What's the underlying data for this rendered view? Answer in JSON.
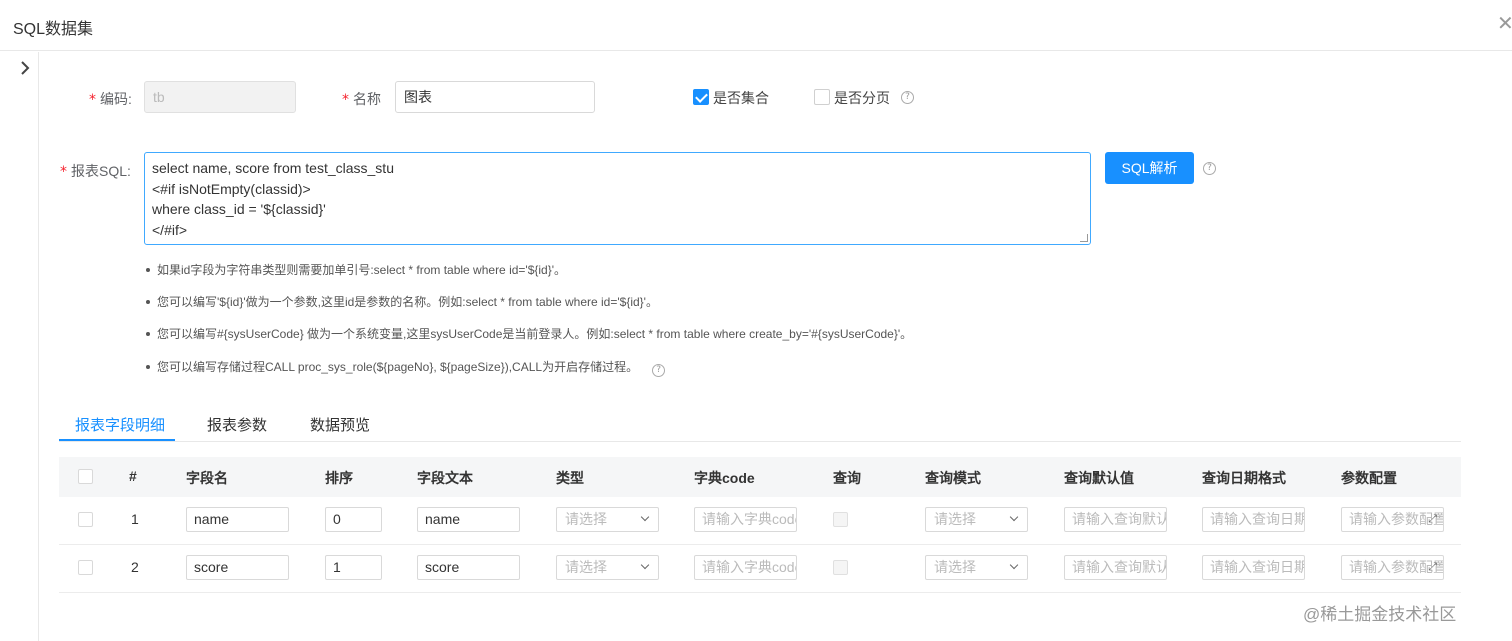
{
  "dialog": {
    "title": "SQL数据集",
    "close_icon": "✕"
  },
  "form": {
    "code": {
      "label": "编码:",
      "value": "tb"
    },
    "name": {
      "label": "名称",
      "value": "图表"
    },
    "is_collection": {
      "label": "是否集合",
      "checked": true
    },
    "is_paged": {
      "label": "是否分页",
      "checked": false
    },
    "sql": {
      "label": "报表SQL:",
      "lines": [
        "select name, score from test_class_stu",
        "<#if isNotEmpty(classid)>",
        "where class_id = '${classid}'",
        "</#if>"
      ]
    },
    "parse_button": "SQL解析",
    "tips": [
      "如果id字段为字符串类型则需要加单引号:select * from table where id='${id}'。",
      "您可以编写'${id}'做为一个参数,这里id是参数的名称。例如:select * from table where id='${id}'。",
      "您可以编写#{sysUserCode} 做为一个系统变量,这里sysUserCode是当前登录人。例如:select * from table where create_by='#{sysUserCode}'。",
      "您可以编写存储过程CALL proc_sys_role(${pageNo}, ${pageSize}),CALL为开启存储过程。"
    ]
  },
  "tabs": [
    {
      "label": "报表字段明细",
      "active": true
    },
    {
      "label": "报表参数",
      "active": false
    },
    {
      "label": "数据预览",
      "active": false
    }
  ],
  "table": {
    "headers": [
      "#",
      "字段名",
      "排序",
      "字段文本",
      "类型",
      "字典code",
      "查询",
      "查询模式",
      "查询默认值",
      "查询日期格式",
      "参数配置"
    ],
    "rows": [
      {
        "index": "1",
        "field": "name",
        "order": "0",
        "text": "name"
      },
      {
        "index": "2",
        "field": "score",
        "order": "1",
        "text": "score"
      }
    ],
    "placeholders": {
      "type": "请选择",
      "dict_code": "请输入字典code",
      "query_mode": "请选择",
      "default_value": "请输入查询默认值",
      "date_format": "请输入查询日期格式",
      "param_config": "请输入参数配置"
    }
  },
  "watermark": "@稀土掘金技术社区"
}
